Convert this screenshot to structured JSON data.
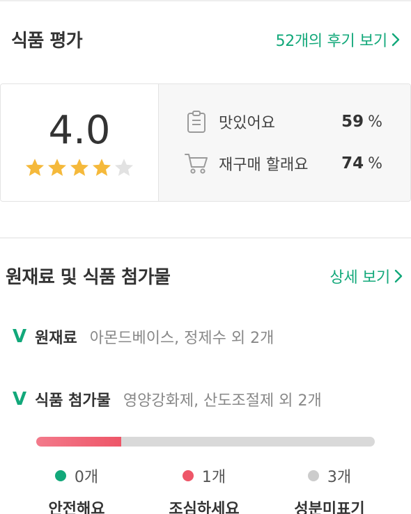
{
  "rating_section": {
    "title": "식품 평가",
    "reviews_link": "52개의 후기 보기",
    "score": "4.0",
    "star_rating": 4,
    "star_max": 5,
    "stats": [
      {
        "icon": "clipboard-icon",
        "label": "맛있어요",
        "value": "59",
        "unit": "%"
      },
      {
        "icon": "cart-icon",
        "label": "재구매 할래요",
        "value": "74",
        "unit": "%"
      }
    ]
  },
  "ingredients_section": {
    "title": "원재료 및 식품 첨가물",
    "detail_link": "상세 보기",
    "rows": [
      {
        "label": "원재료",
        "value": "아몬드베이스, 정제수 외 2개"
      },
      {
        "label": "식품 첨가물",
        "value": "영양강화제, 산도조절제 외 2개"
      }
    ],
    "check_glyph": "V",
    "bar_fill_fraction": 0.25,
    "legend": [
      {
        "count": "0개",
        "label": "안전해요",
        "color": "#12a87a"
      },
      {
        "count": "1개",
        "label": "조심하세요",
        "color": "#ee5668"
      },
      {
        "count": "3개",
        "label": "성분미표기",
        "color": "#cccccc"
      }
    ]
  },
  "colors": {
    "accent": "#12a87a",
    "star_filled": "#f5b93b",
    "star_empty": "#e2e2e2",
    "warning_bar": "#ee5668"
  }
}
